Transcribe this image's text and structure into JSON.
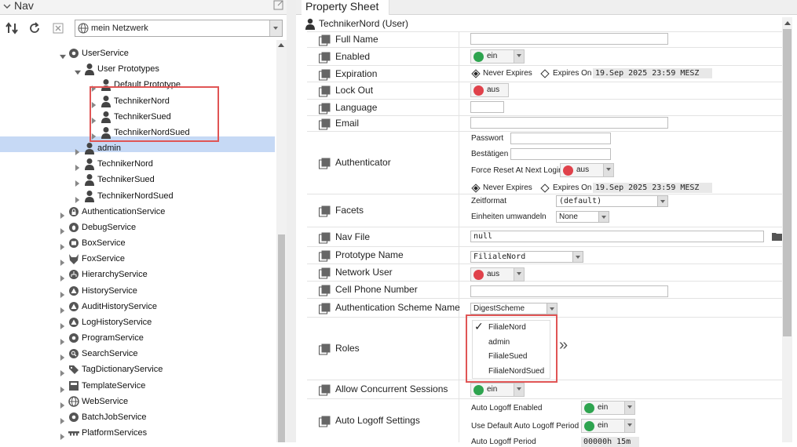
{
  "nav": {
    "title": "Nav",
    "station": "mein Netzwerk",
    "tree": [
      {
        "label": "UserService"
      },
      {
        "label": "User Prototypes"
      },
      {
        "label": "Default Prototype"
      },
      {
        "label": "TechnikerNord"
      },
      {
        "label": "TechnikerSued"
      },
      {
        "label": "TechnikerNordSued"
      },
      {
        "label": "admin"
      },
      {
        "label": "TechnikerNord"
      },
      {
        "label": "TechnikerSued"
      },
      {
        "label": "TechnikerNordSued"
      },
      {
        "label": "AuthenticationService"
      },
      {
        "label": "DebugService"
      },
      {
        "label": "BoxService"
      },
      {
        "label": "FoxService"
      },
      {
        "label": "HierarchyService"
      },
      {
        "label": "HistoryService"
      },
      {
        "label": "AuditHistoryService"
      },
      {
        "label": "LogHistoryService"
      },
      {
        "label": "ProgramService"
      },
      {
        "label": "SearchService"
      },
      {
        "label": "TagDictionaryService"
      },
      {
        "label": "TemplateService"
      },
      {
        "label": "WebService"
      },
      {
        "label": "BatchJobService"
      },
      {
        "label": "PlatformServices"
      }
    ]
  },
  "sheet": {
    "title": "Property Sheet",
    "root": "TechnikerNord  (User)",
    "properties": [
      {
        "label": "Full Name"
      },
      {
        "label": "Enabled"
      },
      {
        "label": "Expiration"
      },
      {
        "label": "Lock Out"
      },
      {
        "label": "Language"
      },
      {
        "label": "Email"
      },
      {
        "label": "Authenticator"
      },
      {
        "label": "Facets"
      },
      {
        "label": "Nav File"
      },
      {
        "label": "Prototype Name"
      },
      {
        "label": "Network User"
      },
      {
        "label": "Cell Phone Number"
      },
      {
        "label": "Authentication Scheme Name"
      },
      {
        "label": "Roles"
      },
      {
        "label": "Allow Concurrent Sessions"
      },
      {
        "label": "Auto Logoff Settings"
      }
    ],
    "values": {
      "enabled": "ein",
      "never_expires": "Never Expires",
      "expires_on": "Expires On",
      "expiration_date": "19.Sep 2025 23:59 MESZ",
      "lock_out": "aus",
      "passwort": "Passwort",
      "bestaetigen": "Bestätigen",
      "force_reset": "Force Reset At Next Login",
      "force_reset_value": "aus",
      "auth_never_expires": "Never Expires",
      "auth_expires_on": "Expires On",
      "auth_expiration_date": "19.Sep 2025 23:59 MESZ",
      "zeitformat": "Zeitformat",
      "zeitformat_value": "(default)",
      "einheiten": "Einheiten umwandeln",
      "einheiten_value": "None",
      "nav_file": "null",
      "prototype_name": "FilialeNord",
      "network_user": "aus",
      "auth_scheme": "DigestScheme",
      "roles": [
        "FilialeNord",
        "admin",
        "FilialeSued",
        "FilialeNordSued"
      ],
      "roles_check": "✓",
      "roles_more": "»",
      "allow_concurrent": "ein",
      "auto_logoff_enabled": "Auto Logoff Enabled",
      "auto_logoff_enabled_value": "ein",
      "use_default_period": "Use Default Auto Logoff Period",
      "use_default_period_value": "ein",
      "auto_logoff_period": "Auto Logoff Period",
      "auto_logoff_period_value": "00000h 15m"
    }
  },
  "colors": {
    "on": "#2ea44f",
    "off": "#e0424b",
    "selection": "#c6d9f5",
    "highlight": "#e05555"
  }
}
